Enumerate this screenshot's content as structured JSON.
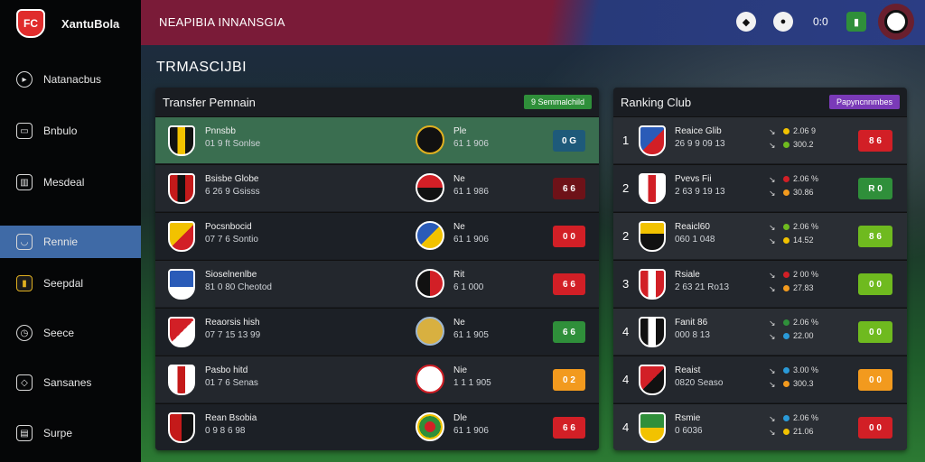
{
  "app": {
    "logo_text": "XantuBola",
    "logo_mark": "FC"
  },
  "header": {
    "title": "NEAPIBIA INNANSGIA",
    "stat": "0:0"
  },
  "sidebar": {
    "items": [
      {
        "label": "Natanacbus",
        "icon": "play-icon"
      },
      {
        "label": "Bnbulo",
        "icon": "cup-icon"
      },
      {
        "label": "Mesdeal",
        "icon": "gift-icon"
      },
      {
        "label": "Rennie",
        "icon": "shield-icon"
      },
      {
        "label": "Seepdal",
        "icon": "club-badge-icon"
      },
      {
        "label": "Seece",
        "icon": "clock-icon"
      },
      {
        "label": "Sansanes",
        "icon": "shield-outline-icon"
      },
      {
        "label": "Surpe",
        "icon": "document-icon"
      }
    ]
  },
  "section_title": "TRMASCIJBI",
  "transfer": {
    "title": "Transfer Pemnain",
    "badge": "9 Semmalchild",
    "badge_color": "#2f8f3a",
    "rows": [
      {
        "name": "Pnnsbb",
        "sub": "01 9 ft Sonlse",
        "target_name": "Ple",
        "target_sub": "61 1 906",
        "score": "0 G",
        "color": "#1e5a7a"
      },
      {
        "name": "Bsisbe Globe",
        "sub": "6 26 9 Gsisss",
        "target_name": "Ne",
        "target_sub": "61 1 986",
        "score": "6 6",
        "color": "#6e1218"
      },
      {
        "name": "Pocsnbocid",
        "sub": "07 7 6 Sontio",
        "target_name": "Ne",
        "target_sub": "61 1 906",
        "score": "0 0",
        "color": "#d21f26"
      },
      {
        "name": "Sioselnenlbe",
        "sub": "81 0 80 Cheotod",
        "target_name": "Rit",
        "target_sub": "6 1 000",
        "score": "6 6",
        "color": "#d21f26"
      },
      {
        "name": "Reaorsis hish",
        "sub": "07 7 15 13 99",
        "target_name": "Ne",
        "target_sub": "61 1 905",
        "score": "6 6",
        "color": "#2f8f3a"
      },
      {
        "name": "Pasbo hitd",
        "sub": "01 7 6 Senas",
        "target_name": "Nie",
        "target_sub": "1 1 1 905",
        "score": "0 2",
        "color": "#f29a1e"
      },
      {
        "name": "Rean Bsobia",
        "sub": "0 9 8 6 98",
        "target_name": "Dle",
        "target_sub": "61 1 906",
        "score": "6 6",
        "color": "#d21f26"
      }
    ]
  },
  "ranking": {
    "title": "Ranking Club",
    "badge": "Papyncnnmbes",
    "badge_color": "#7a3ab8",
    "rows": [
      {
        "rank": "1",
        "name": "Reaice Glib",
        "sub": "26 9 9 09 13",
        "a": "2.06 9",
        "b": "300.2",
        "score": "8 6",
        "color": "#d21f26"
      },
      {
        "rank": "2",
        "name": "Pvevs Fii",
        "sub": "2 63 9 19 13",
        "a": "2.06 %",
        "b": "30.86",
        "score": "R 0",
        "color": "#2f8f3a"
      },
      {
        "rank": "2",
        "name": "Reaicl60",
        "sub": "060 1 048",
        "a": "2.06 %",
        "b": "14.52",
        "score": "8 6",
        "color": "#6fba1f"
      },
      {
        "rank": "3",
        "name": "Rsiale",
        "sub": "2 63 21 Ro13",
        "a": "2 00 %",
        "b": "27.83",
        "score": "0 0",
        "color": "#6fba1f"
      },
      {
        "rank": "4",
        "name": "Fanit 86",
        "sub": "000 8 13",
        "a": "2.06 %",
        "b": "22.00",
        "score": "0 0",
        "color": "#6fba1f"
      },
      {
        "rank": "4",
        "name": "Reaist",
        "sub": "0820 Seaso",
        "a": "3.00 %",
        "b": "300.3",
        "score": "0 0",
        "color": "#f29a1e"
      },
      {
        "rank": "4",
        "name": "Rsmie",
        "sub": "0 6036",
        "a": "2.06 %",
        "b": "21.06",
        "score": "0 0",
        "color": "#d21f26"
      }
    ]
  }
}
